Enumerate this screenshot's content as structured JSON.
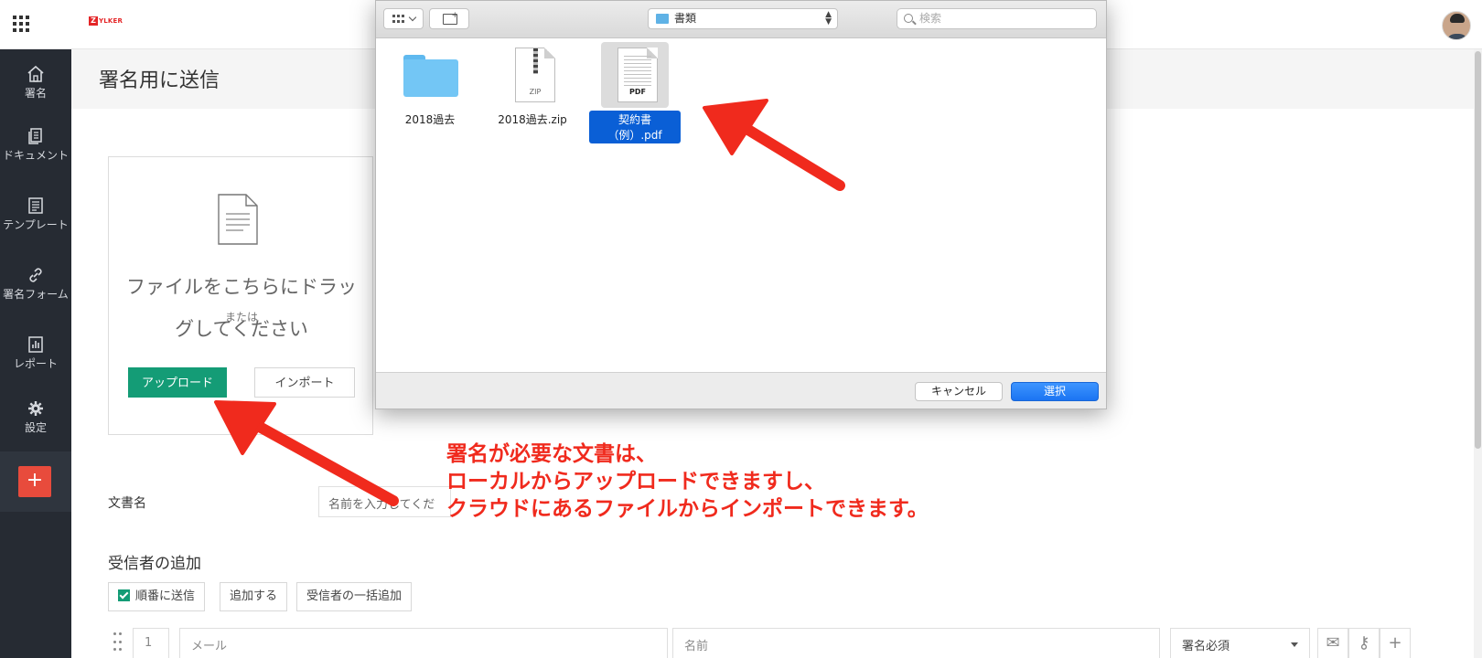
{
  "topbar": {
    "logo_text": "YLKER",
    "logo_mark": "Z"
  },
  "sidebar": {
    "items": [
      {
        "label": "署名",
        "icon": "home-icon"
      },
      {
        "label": "ドキュメント",
        "icon": "documents-icon"
      },
      {
        "label": "テンプレート",
        "icon": "template-icon"
      },
      {
        "label": "署名フォーム",
        "icon": "link-icon"
      },
      {
        "label": "レポート",
        "icon": "report-icon"
      },
      {
        "label": "設定",
        "icon": "gear-icon"
      }
    ],
    "new_button": "+"
  },
  "page": {
    "title": "署名用に送信"
  },
  "upload": {
    "drop_line1": "ファイルをこちらにドラッ",
    "drop_line2": "グしてください",
    "or": "または",
    "upload_button": "アップロード",
    "import_button": "インポート"
  },
  "form": {
    "doc_name_label": "文書名",
    "doc_name_placeholder": "名前を入力してくだ",
    "recipients_title": "受信者の追加",
    "sequential_label": "順番に送信",
    "sequential_checked": true,
    "add_button": "追加する",
    "bulk_add_button": "受信者の一括追加",
    "recipient_row": {
      "index": "1",
      "email_placeholder": "メール",
      "name_placeholder": "名前",
      "role": "署名必須"
    }
  },
  "dialog": {
    "location": "書類",
    "search_placeholder": "検索",
    "files": [
      {
        "name": "2018過去",
        "type": "folder",
        "selected": false
      },
      {
        "name": "2018過去.zip",
        "type": "zip",
        "tag": "ZIP",
        "selected": false
      },
      {
        "name": "契約書（例）.pdf",
        "type": "pdf",
        "tag": "PDF",
        "selected": true
      }
    ],
    "cancel_button": "キャンセル",
    "select_button": "選択"
  },
  "annotation": {
    "lines": [
      "署名が必要な文書は、",
      "ローカルからアップロードできますし、",
      "クラウドにあるファイルからインポートできます。"
    ],
    "color": "#f02a1d"
  },
  "colors": {
    "accent_green": "#149c76",
    "sidebar_bg": "#262b33",
    "new_button": "#e84b3c",
    "dialog_primary": "#1b74f2"
  }
}
